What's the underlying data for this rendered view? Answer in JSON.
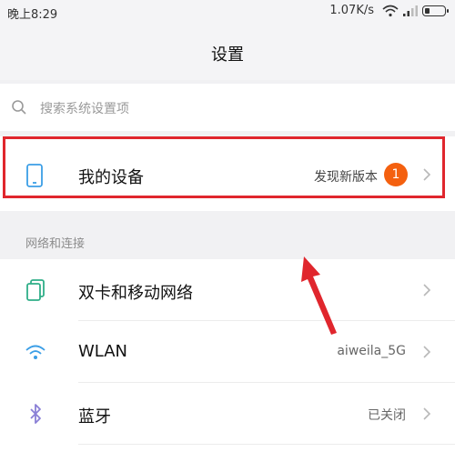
{
  "status_bar": {
    "time": "晚上8:29",
    "network_speed": "1.07K/s",
    "icons": [
      "wifi-icon",
      "signal-icon",
      "battery-icon"
    ]
  },
  "header": {
    "title": "设置"
  },
  "search": {
    "placeholder": "搜索系统设置项"
  },
  "my_device": {
    "label": "我的设备",
    "hint": "发现新版本",
    "badge": "1",
    "highlight_color": "#e0262d",
    "badge_color": "#f4600f"
  },
  "network_section": {
    "title": "网络和连接",
    "items": [
      {
        "icon": "dual-sim-icon",
        "label": "双卡和移动网络",
        "value": ""
      },
      {
        "icon": "wifi-icon",
        "label": "WLAN",
        "value": "aiweila_5G"
      },
      {
        "icon": "bluetooth-icon",
        "label": "蓝牙",
        "value": "已关闭"
      }
    ]
  },
  "colors": {
    "accent_green": "#2fae88",
    "accent_blue": "#3b9ee6",
    "accent_purple": "#8a7fd6",
    "annotation_red": "#e0262d"
  }
}
